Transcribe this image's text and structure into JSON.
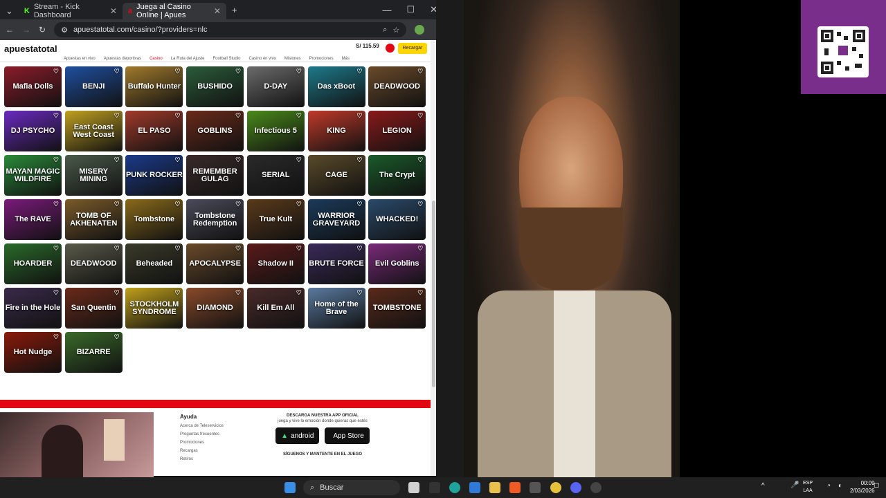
{
  "browser": {
    "tabs": [
      {
        "title": "Stream - Kick Dashboard"
      },
      {
        "title": "Juega al Casino Online | Apues"
      }
    ],
    "url": "apuestatotal.com/casino/?providers=nlc"
  },
  "site": {
    "logo": "apuestatotal",
    "nav": [
      "Apuestas en vivo",
      "Apuestas deportivas",
      "Casino",
      "La Ruta del Ajuste",
      "Football Studio",
      "Casino en vivo",
      "Misiones",
      "Promociones",
      "Más"
    ],
    "active_nav": "Casino",
    "balance": "S/ 115.59",
    "recharge_label": "Recargar"
  },
  "games": [
    {
      "name": "Mafia Dolls",
      "color": "#8b1c2a"
    },
    {
      "name": "BENJI",
      "color": "#1f4fa0"
    },
    {
      "name": "Buffalo Hunter",
      "color": "#a17a2c"
    },
    {
      "name": "BUSHIDO",
      "color": "#2b5c3a"
    },
    {
      "name": "D-DAY",
      "color": "#6b6b6b"
    },
    {
      "name": "Das xBoot",
      "color": "#1d7a8c"
    },
    {
      "name": "DEADWOOD",
      "color": "#6a4a2a"
    },
    {
      "name": "DJ PSYCHO",
      "color": "#6a2ac0"
    },
    {
      "name": "East Coast West Coast",
      "color": "#c0a020"
    },
    {
      "name": "EL PASO",
      "color": "#a03a2a"
    },
    {
      "name": "GOBLINS",
      "color": "#6a2a1a"
    },
    {
      "name": "Infectious 5",
      "color": "#4a8a1a"
    },
    {
      "name": "KING",
      "color": "#c03a2a"
    },
    {
      "name": "LEGION",
      "color": "#8a1a1a"
    },
    {
      "name": "MAYAN MAGIC WILDFIRE",
      "color": "#2a8a3a"
    },
    {
      "name": "MISERY MINING",
      "color": "#4a5a4a"
    },
    {
      "name": "PUNK ROCKER",
      "color": "#1a3a8a"
    },
    {
      "name": "REMEMBER GULAG",
      "color": "#3a2a2a"
    },
    {
      "name": "SERIAL",
      "color": "#2a2a2a"
    },
    {
      "name": "CAGE",
      "color": "#5a4a2a"
    },
    {
      "name": "The Crypt",
      "color": "#1a5a2a"
    },
    {
      "name": "The RAVE",
      "color": "#7a1a7a"
    },
    {
      "name": "TOMB OF AKHENATEN",
      "color": "#7a5a2a"
    },
    {
      "name": "Tombstone",
      "color": "#8a6a1a"
    },
    {
      "name": "Tombstone Redemption",
      "color": "#4a4a5a"
    },
    {
      "name": "True Kult",
      "color": "#5a3a1a"
    },
    {
      "name": "WARRIOR GRAVEYARD",
      "color": "#1a3a5a"
    },
    {
      "name": "WHACKED!",
      "color": "#2a4a6a"
    },
    {
      "name": "HOARDER",
      "color": "#2a6a2a"
    },
    {
      "name": "DEADWOOD",
      "color": "#5a5a4a"
    },
    {
      "name": "Beheaded",
      "color": "#3a3a2a"
    },
    {
      "name": "APOCALYPSE",
      "color": "#6a4a2a"
    },
    {
      "name": "Shadow II",
      "color": "#5a1a1a"
    },
    {
      "name": "BRUTE FORCE",
      "color": "#3a2a5a"
    },
    {
      "name": "Evil Goblins",
      "color": "#7a2a7a"
    },
    {
      "name": "Fire in the Hole",
      "color": "#3a2a4a"
    },
    {
      "name": "San Quentin",
      "color": "#6a2a1a"
    },
    {
      "name": "STOCKHOLM SYNDROME",
      "color": "#c0a01a"
    },
    {
      "name": "DIAMOND",
      "color": "#8a4a2a"
    },
    {
      "name": "Kill Em All",
      "color": "#4a2a2a"
    },
    {
      "name": "Home of the Brave",
      "color": "#5a7aa0"
    },
    {
      "name": "TOMBSTONE",
      "color": "#5a2a1a"
    },
    {
      "name": "Hot Nudge",
      "color": "#8a1a0a"
    },
    {
      "name": "BIZARRE",
      "color": "#3a6a2a"
    }
  ],
  "footer": {
    "help_title": "Ayuda",
    "help_links": [
      "Acerca de Teleservicios",
      "Preguntas frecuentes",
      "Promociones",
      "Recargas",
      "Retiros"
    ],
    "app_title": "DESCARGA NUESTRA APP OFICIAL",
    "app_subtitle": "juega y vive la emoción donde quieras que estés",
    "android": "android",
    "appstore": "App Store",
    "follow": "SÍGUENOS Y MANTENTE EN EL JUEGO"
  },
  "taskbar": {
    "search": "Buscar",
    "lang": [
      "ESP",
      "LAA"
    ],
    "time": "00:09",
    "date": "2/03/2026"
  }
}
